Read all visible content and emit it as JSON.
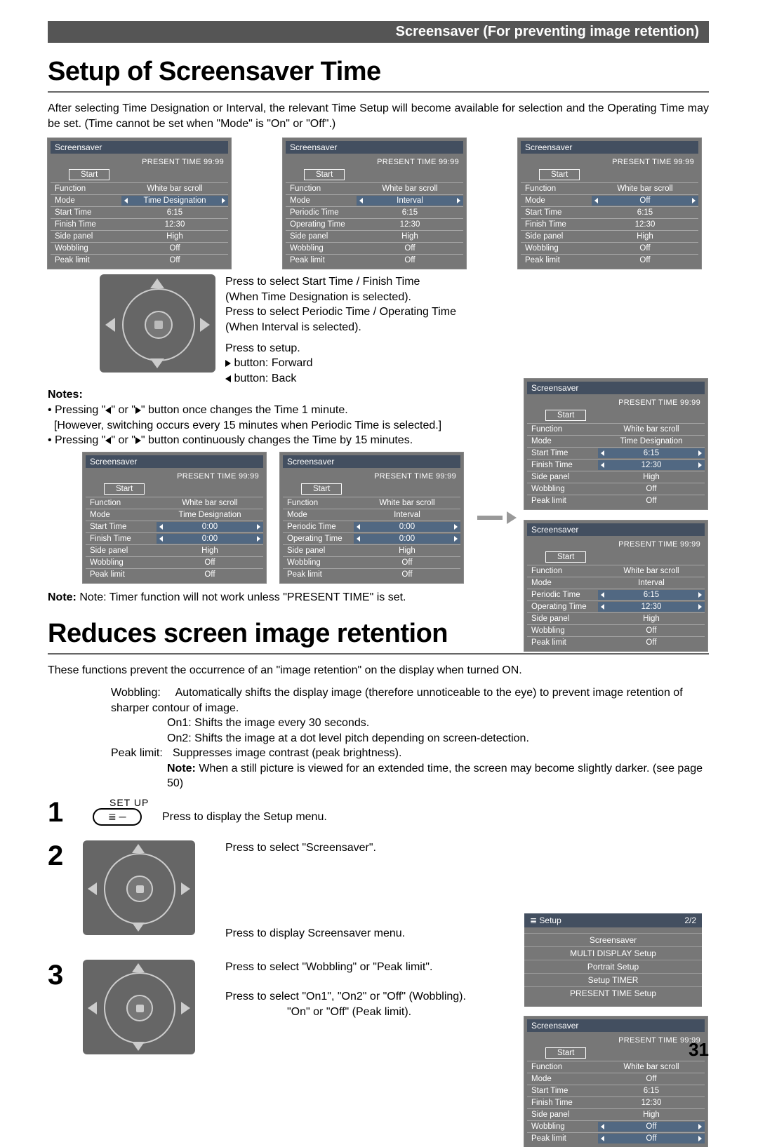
{
  "header": "Screensaver (For preventing image retention)",
  "h1": "Setup of Screensaver Time",
  "intro": "After selecting Time Designation or Interval, the relevant Time Setup will become available for selection and the Operating Time may be set. (Time cannot be set when \"Mode\" is \"On\" or \"Off\".)",
  "osd": {
    "title": "Screensaver",
    "present": "PRESENT  TIME    99:99",
    "start": "Start",
    "labs": {
      "function": "Function",
      "mode": "Mode",
      "stime": "Start Time",
      "ftime": "Finish Time",
      "side": "Side panel",
      "wobb": "Wobbling",
      "peak": "Peak limit",
      "ptime": "Periodic Time",
      "otime": "Operating Time"
    },
    "vals": {
      "wbs": "White bar scroll",
      "td": "Time Designation",
      "intv": "Interval",
      "off": "Off",
      "high": "High",
      "zero": "0:00",
      "v615": "6:15",
      "v1230": "12:30"
    }
  },
  "instr": {
    "l1": "Press to select Start Time / Finish Time",
    "l2": "(When Time Designation is selected).",
    "l3": "Press to select Periodic Time / Operating Time",
    "l4": "(When Interval is selected).",
    "l5": "Press to setup.",
    "l6": " button: Forward",
    "l7": " button: Back"
  },
  "notes": {
    "hdr": "Notes:",
    "n1a": "Pressing \"",
    "n1b": "\" or \"",
    "n1c": "\" button once changes the Time 1 minute.",
    "n2": "[However, switching occurs every 15 minutes when Periodic Time is selected.]",
    "n3a": "Pressing \"",
    "n3b": "\" or \"",
    "n3c": "\" button continuously changes the Time by 15 minutes."
  },
  "note2": "Note: Timer function will not work unless \"PRESENT TIME\" is set.",
  "h2": "Reduces screen image retention",
  "p2": "These functions prevent the occurrence of an \"image retention\" on the display when turned ON.",
  "wobb": {
    "lbl": "Wobbling:",
    "t": " Automatically shifts the display image (therefore unnoticeable to the eye) to prevent image retention of sharper contour of image.",
    "on1": "On1: Shifts the image every 30 seconds.",
    "on2": "On2: Shifts the image at a dot level pitch depending on screen-detection.",
    "pl_lbl": "Peak limit:",
    "pl": "Suppresses image contrast (peak brightness).",
    "note_l": "Note:",
    "note": " When a still picture is viewed for an extended time, the screen may become slightly darker. (see page 50)"
  },
  "steps": {
    "setup": "SET UP",
    "s1": "Press to display the Setup menu.",
    "s2": "Press to select \"Screensaver\".",
    "s2b": "Press to display Screensaver menu.",
    "s3a": "Press to select \"Wobbling\" or \"Peak limit\".",
    "s3b": "Press to select \"On1\", \"On2\" or \"Off\" (Wobbling).",
    "s3c": "\"On\" or \"Off\" (Peak limit)."
  },
  "setup_menu": {
    "title": "Setup",
    "pg": "2/2",
    "items": [
      "Screensaver",
      "MULTI DISPLAY Setup",
      "Portrait Setup",
      "Setup TIMER",
      "PRESENT TIME Setup"
    ]
  },
  "pagenum": "31"
}
